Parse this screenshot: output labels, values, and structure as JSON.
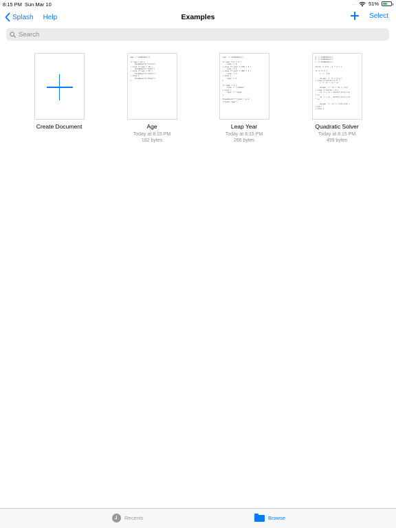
{
  "status_bar": {
    "time": "8:15 PM",
    "date": "Sun Mar 10",
    "signal_dots": "....",
    "battery_percent": "51%",
    "battery_level": 0.51,
    "battery_color": "#34c759"
  },
  "nav": {
    "back_label": "Splash",
    "help_label": "Help",
    "title": "Examples",
    "add_icon": "plus-icon",
    "select_label": "Select",
    "accent_color": "#0a7aff"
  },
  "search": {
    "placeholder": "Search",
    "value": ""
  },
  "documents": [
    {
      "name": "Create Document",
      "date": "",
      "size": "",
      "preview": ""
    },
    {
      "name": "Age",
      "date": "Today at 8:15 PM",
      "size": "182 bytes",
      "preview": "age := AskNumber()\n\nif age < 12 {\n    ShowResult(\"Child\")\n} else if age < 18 {\n    ShowResult(\"Teen\")\n} else if age < 60 {\n    ShowResult(\"Adult\")\n} else {\n    ShowResult(\"Elder\")\n}"
    },
    {
      "name": "Leap Year",
      "date": "Today at 8:15 PM",
      "size": "266 bytes",
      "preview": "year := AskNumber()\n\nif year % 4 = 0 {\n    leap := 0\n} else if year % 100 = 0 {\n    leap := 1\n} else if year % 400 = 0 {\n    leap := 0\n} else {\n    leap := 1\n}\n\nif leap = 0 {\n    type := \"common\"\n} else {\n    type := \"leap\"\n}\n\nShowResult(\"\\(year) is a\n\\(type) year\")"
    },
    {
      "name": "Quadratic Solver",
      "date": "Today at 8:15 PM",
      "size": "499 bytes",
      "preview": "a := AskNumber()\nb := AskNumber()\nc := AskNumber()\n\ndelta := b^2 - 4 * a * c\n\nif a == 0 {\n    x := -c/b\n\n    answer := \"x = \\(x)\"\n} else if delta == 0 {\n    x := -b / (2 * a)\n\n    answer := \"x1 = x2 = \\(x)\"\n} else if delta > 0 {\n    x1 := (-b + delta^(1/2))/(2\n* a)\n    x2 := (-b - delta^(1/2))/(2\n* a)\n\n    answer := \"x1 = \\(x1)\\nx2 =\n\\(x2)\"\n} else {"
    }
  ],
  "tab_bar": {
    "recents_label": "Recents",
    "browse_label": "Browse",
    "selected": "Browse"
  }
}
